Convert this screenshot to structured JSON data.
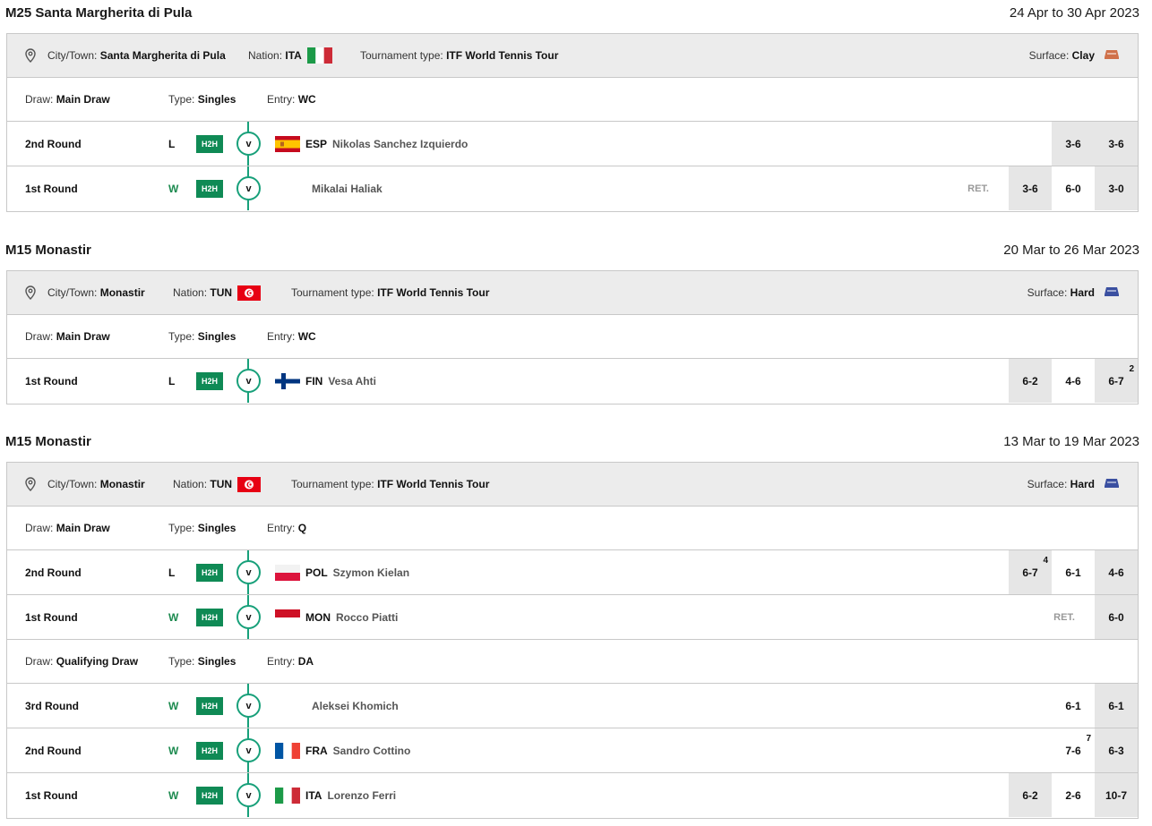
{
  "tournaments": [
    {
      "name": "M25 Santa Margherita di Pula",
      "dates": "24 Apr to 30 Apr 2023",
      "info": {
        "city_label": "City/Town:",
        "city": "Santa Margherita di Pula",
        "nation_label": "Nation:",
        "nation": "ITA",
        "nation_flag": "italy-flag",
        "type_label": "Tournament type:",
        "type": "ITF World Tennis Tour",
        "surface_label": "Surface:",
        "surface": "Clay",
        "surface_color": "#d0714a"
      },
      "draws": [
        {
          "draw_label": "Draw:",
          "draw": "Main Draw",
          "type_label": "Type:",
          "type": "Singles",
          "entry_label": "Entry:",
          "entry": "WC",
          "matches": [
            {
              "round": "2nd Round",
              "result": "L",
              "h2h": "H2H",
              "vs": "v",
              "flag": "spain-flag",
              "code": "ESP",
              "opponent": "Nikolas Sanchez Izquierdo",
              "ret": "",
              "scores": [
                {
                  "s": "3-6",
                  "sup": ""
                },
                {
                  "s": "3-6",
                  "sup": ""
                }
              ]
            },
            {
              "round": "1st Round",
              "result": "W",
              "h2h": "H2H",
              "vs": "v",
              "flag": "",
              "code": "",
              "opponent": "Mikalai Haliak",
              "ret": "RET.",
              "scores": [
                {
                  "s": "3-6",
                  "sup": ""
                },
                {
                  "s": "6-0",
                  "sup": ""
                },
                {
                  "s": "3-0",
                  "sup": ""
                }
              ]
            }
          ]
        }
      ]
    },
    {
      "name": "M15 Monastir",
      "dates": "20 Mar to 26 Mar 2023",
      "info": {
        "city_label": "City/Town:",
        "city": "Monastir",
        "nation_label": "Nation:",
        "nation": "TUN",
        "nation_flag": "tunisia-flag",
        "type_label": "Tournament type:",
        "type": "ITF World Tennis Tour",
        "surface_label": "Surface:",
        "surface": "Hard",
        "surface_color": "#3a4fa0"
      },
      "draws": [
        {
          "draw_label": "Draw:",
          "draw": "Main Draw",
          "type_label": "Type:",
          "type": "Singles",
          "entry_label": "Entry:",
          "entry": "WC",
          "matches": [
            {
              "round": "1st Round",
              "result": "L",
              "h2h": "H2H",
              "vs": "v",
              "flag": "finland-flag",
              "code": "FIN",
              "opponent": "Vesa Ahti",
              "ret": "",
              "scores": [
                {
                  "s": "6-2",
                  "sup": ""
                },
                {
                  "s": "4-6",
                  "sup": ""
                },
                {
                  "s": "6-7",
                  "sup": "2"
                }
              ]
            }
          ]
        }
      ]
    },
    {
      "name": "M15 Monastir",
      "dates": "13 Mar to 19 Mar 2023",
      "info": {
        "city_label": "City/Town:",
        "city": "Monastir",
        "nation_label": "Nation:",
        "nation": "TUN",
        "nation_flag": "tunisia-flag",
        "type_label": "Tournament type:",
        "type": "ITF World Tennis Tour",
        "surface_label": "Surface:",
        "surface": "Hard",
        "surface_color": "#3a4fa0"
      },
      "draws": [
        {
          "draw_label": "Draw:",
          "draw": "Main Draw",
          "type_label": "Type:",
          "type": "Singles",
          "entry_label": "Entry:",
          "entry": "Q",
          "matches": [
            {
              "round": "2nd Round",
              "result": "L",
              "h2h": "H2H",
              "vs": "v",
              "flag": "poland-flag",
              "code": "POL",
              "opponent": "Szymon Kielan",
              "ret": "",
              "scores": [
                {
                  "s": "6-7",
                  "sup": "4"
                },
                {
                  "s": "6-1",
                  "sup": ""
                },
                {
                  "s": "4-6",
                  "sup": ""
                }
              ]
            },
            {
              "round": "1st Round",
              "result": "W",
              "h2h": "H2H",
              "vs": "v",
              "flag": "monaco-flag",
              "code": "MON",
              "opponent": "Rocco Piatti",
              "ret": "RET.",
              "scores": [
                {
                  "s": "6-0",
                  "sup": ""
                }
              ]
            }
          ]
        },
        {
          "draw_label": "Draw:",
          "draw": "Qualifying Draw",
          "type_label": "Type:",
          "type": "Singles",
          "entry_label": "Entry:",
          "entry": "DA",
          "matches": [
            {
              "round": "3rd Round",
              "result": "W",
              "h2h": "H2H",
              "vs": "v",
              "flag": "",
              "code": "",
              "opponent": "Aleksei Khomich",
              "ret": "",
              "scores": [
                {
                  "s": "6-1",
                  "sup": ""
                },
                {
                  "s": "6-1",
                  "sup": ""
                }
              ]
            },
            {
              "round": "2nd Round",
              "result": "W",
              "h2h": "H2H",
              "vs": "v",
              "flag": "france-flag",
              "code": "FRA",
              "opponent": "Sandro Cottino",
              "ret": "",
              "scores": [
                {
                  "s": "7-6",
                  "sup": "7"
                },
                {
                  "s": "6-3",
                  "sup": ""
                }
              ]
            },
            {
              "round": "1st Round",
              "result": "W",
              "h2h": "H2H",
              "vs": "v",
              "flag": "italy-flag",
              "code": "ITA",
              "opponent": "Lorenzo Ferri",
              "ret": "",
              "scores": [
                {
                  "s": "6-2",
                  "sup": ""
                },
                {
                  "s": "2-6",
                  "sup": ""
                },
                {
                  "s": "10-7",
                  "sup": ""
                }
              ]
            }
          ]
        }
      ]
    }
  ]
}
